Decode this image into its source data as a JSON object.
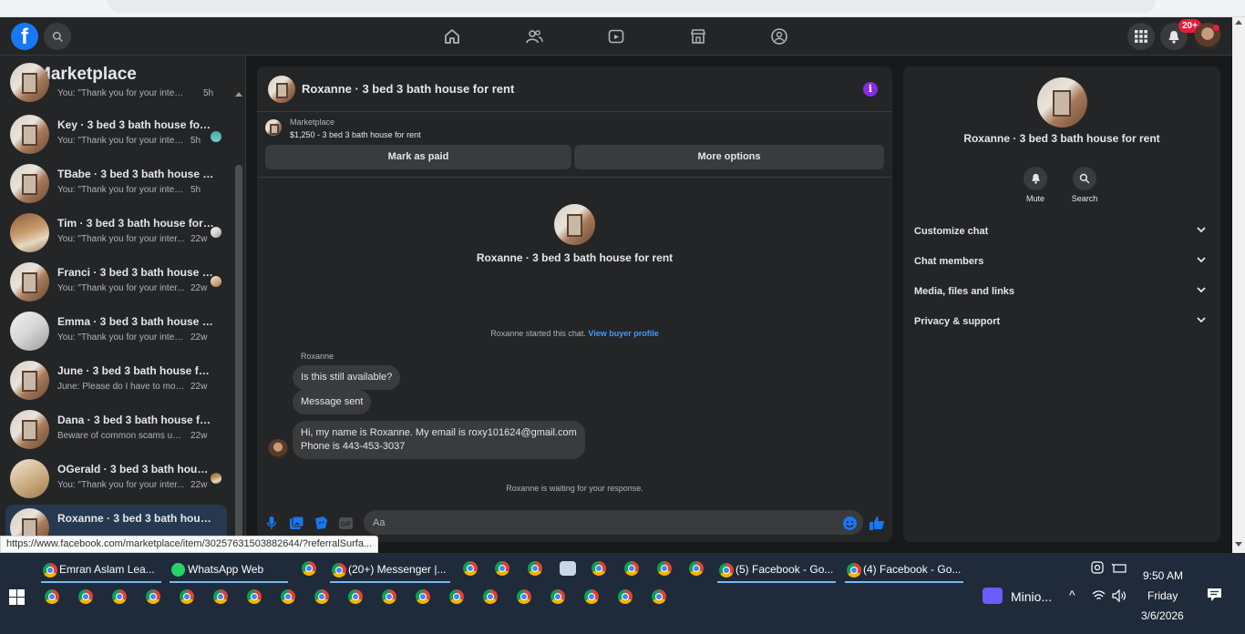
{
  "colors": {
    "accent": "#1877f2",
    "link": "#4599ff",
    "badge": "#e41e3f",
    "info": "#8a2be2"
  },
  "topnav": {
    "logo": "f",
    "notification_badge": "20+",
    "icons": [
      "home-icon",
      "friends-icon",
      "video-icon",
      "marketplace-icon",
      "groups-icon",
      "menu-grid-icon",
      "bell-icon"
    ]
  },
  "sidebar": {
    "title": "Marketplace",
    "conversations": [
      {
        "name": "",
        "preview": "You: \"Thank you for your interest. ...",
        "time": "5h"
      },
      {
        "name": "Key · 3 bed 3 bath house for ...",
        "preview": "You: \"Thank you for your interes...",
        "time": "5h"
      },
      {
        "name": "TBabe · 3 bed 3 bath house for ...",
        "preview": "You: \"Thank you for your interest. ...",
        "time": "5h"
      },
      {
        "name": "Tim · 3 bed 3 bath house for ...",
        "preview": "You: \"Thank you for your inter...",
        "time": "22w"
      },
      {
        "name": "Franci · 3 bed 3 bath house f...",
        "preview": "You: \"Thank you for your inter...",
        "time": "22w"
      },
      {
        "name": "Emma · 3 bed 3 bath house for ...",
        "preview": "You: \"Thank you for your interest....",
        "time": "22w"
      },
      {
        "name": "June · 3 bed 3 bath house for re...",
        "preview": "June: Please do I have to move b...",
        "time": "22w"
      },
      {
        "name": "Dana · 3 bed 3 bath house for r...",
        "preview": "Beware of common scams using ...",
        "time": "22w"
      },
      {
        "name": "OGerald · 3 bed 3 bath house...",
        "preview": "You: \"Thank you for your inter...",
        "time": "22w"
      },
      {
        "name": "Roxanne · 3 bed 3 bath house f...",
        "preview": "",
        "time": ""
      }
    ]
  },
  "chat": {
    "title": "Roxanne · 3 bed 3 bath house for rent",
    "listing_source": "Marketplace",
    "listing_price": "$1,250 - 3 bed 3 bath house for rent",
    "mark_paid_label": "Mark as paid",
    "more_options_label": "More options",
    "profile_name": "Roxanne · 3 bed 3 bath house for rent",
    "started_text": "Roxanne started this chat.",
    "view_buyer_link": "View buyer profile",
    "sender_name": "Roxanne",
    "messages": [
      {
        "line1": "Is this still available?",
        "line2": ""
      },
      {
        "line1": "Message sent",
        "line2": ""
      },
      {
        "line1": "Hi, my name is Roxanne. My email is roxy101624@gmail.com",
        "line2": "Phone is 443-453-3037"
      }
    ],
    "waiting_text": "Roxanne is waiting for your response.",
    "input_placeholder": "Aa"
  },
  "info_panel": {
    "name": "Roxanne · 3 bed 3 bath house for rent",
    "mute_label": "Mute",
    "search_label": "Search",
    "sections": [
      "Customize chat",
      "Chat members",
      "Media, files and links",
      "Privacy & support"
    ]
  },
  "status_url": "https://www.facebook.com/marketplace/item/30257631503882644/?referralSurfa...",
  "taskbar": {
    "windows": [
      "Emran Aslam Lea...",
      "WhatsApp Web",
      "(20+) Messenger |...",
      "(5) Facebook - Go...",
      "(4) Facebook - Go..."
    ],
    "minio_label": "Minio...",
    "time": "9:50 AM",
    "day": "Friday",
    "date": "3/6/2026"
  }
}
